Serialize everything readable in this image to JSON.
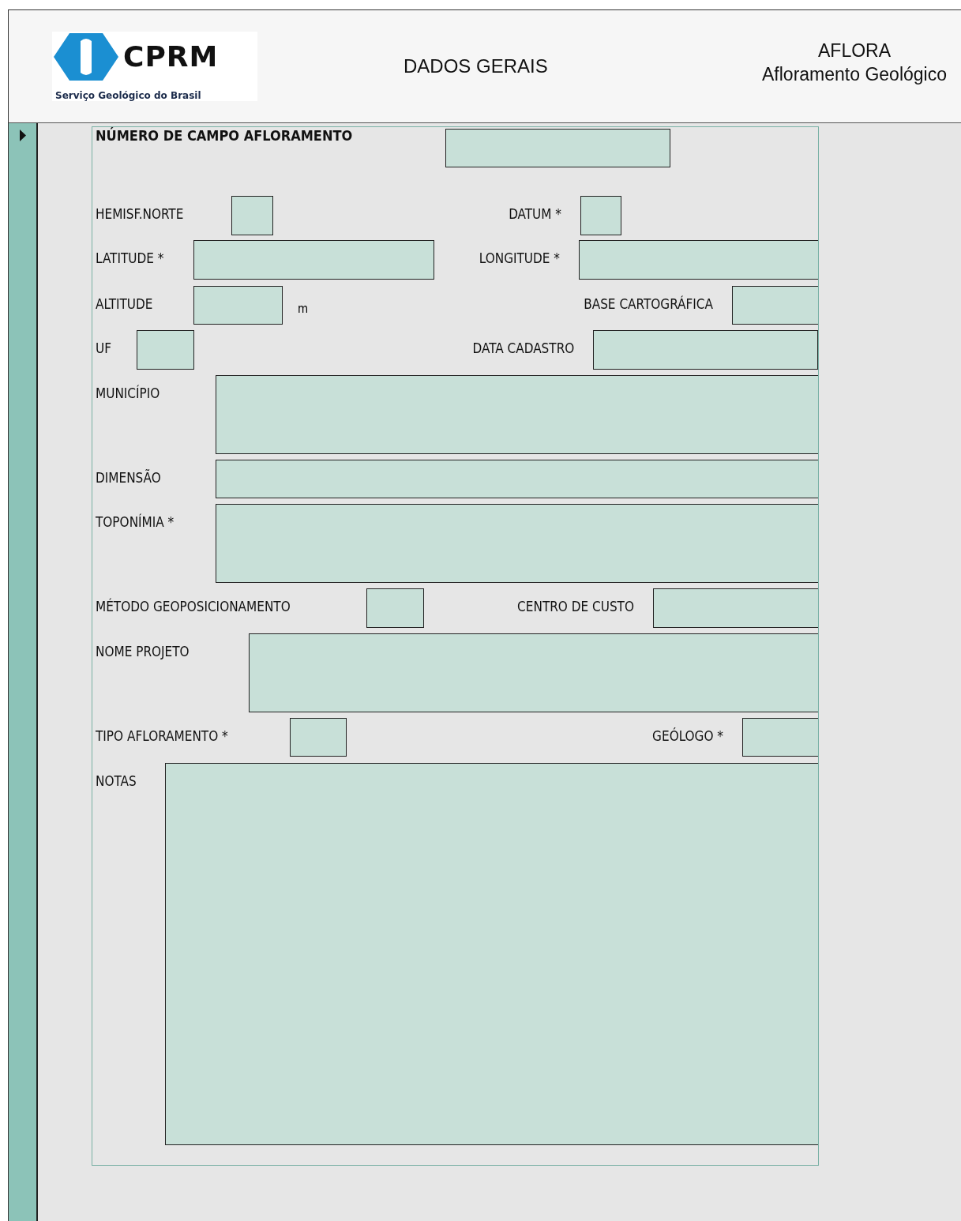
{
  "header": {
    "logo": {
      "name": "CPRM",
      "subtitle": "Serviço Geológico do Brasil"
    },
    "title": "DADOS GERAIS",
    "app": {
      "name": "AFLORA",
      "subtitle": "Afloramento Geológico"
    }
  },
  "form": {
    "rows": [
      {
        "kind": "key",
        "label": "NÚMERO DE CAMPO AFLORAMENTO"
      },
      {
        "kind": "field",
        "label": "HEMISF.NORTE",
        "right": "DATUM *"
      },
      {
        "kind": "field",
        "label": "LATITUDE *",
        "right": "LONGITUDE *"
      },
      {
        "kind": "field",
        "label": "ALTITUDE",
        "unit": "m",
        "right": "BASE CARTOGRÁFICA"
      },
      {
        "kind": "field",
        "label": "UF",
        "right": "DATA CADASTRO"
      },
      {
        "kind": "field",
        "label": "MUNICÍPIO"
      },
      {
        "kind": "field",
        "label": "DIMENSÃO"
      },
      {
        "kind": "field",
        "label": "TOPONÍMIA *"
      },
      {
        "kind": "field",
        "label": "MÉTODO GEOPOSICIONAMENTO",
        "right": "CENTRO DE CUSTO"
      },
      {
        "kind": "field",
        "label": "NOME PROJETO"
      },
      {
        "kind": "field",
        "label": "TIPO AFLORAMENTO *",
        "right": "GEÓLOGO *"
      },
      {
        "kind": "field",
        "label": "NOTAS"
      }
    ]
  }
}
